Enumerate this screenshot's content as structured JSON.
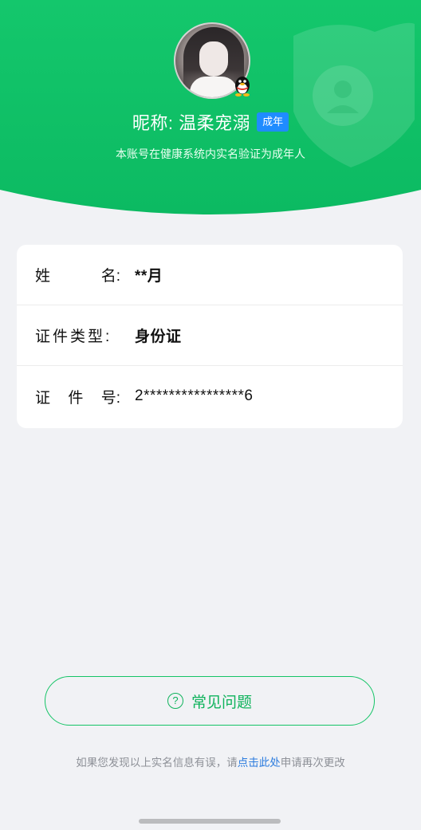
{
  "header": {
    "nickname_prefix": "昵称:",
    "nickname": "温柔宠溺",
    "badge": "成年",
    "subtitle": "本账号在健康系统内实名验证为成年人",
    "colors": {
      "gradient_start": "#0fbf67",
      "gradient_end": "#1ac86f",
      "accent": "#14c466"
    },
    "avatar_icon": "user-avatar",
    "platform_icon": "qq-penguin-icon",
    "background_icon": "shield-user-icon"
  },
  "info_card": {
    "rows": [
      {
        "label_chars": [
          "姓",
          "名:"
        ],
        "value": "**月"
      },
      {
        "label_chars": [
          "证件类型:"
        ],
        "value": "身份证"
      },
      {
        "label_chars": [
          "证",
          "件",
          "号:"
        ],
        "value": "2****************6"
      }
    ]
  },
  "faq": {
    "label": "常见问题",
    "icon": "question-circle-icon",
    "icon_glyph": "?"
  },
  "footer": {
    "text_before": "如果您发现以上实名信息有误，请",
    "link": "点击此处",
    "text_after": "申请再次更改",
    "link_color": "#2a7bde"
  }
}
